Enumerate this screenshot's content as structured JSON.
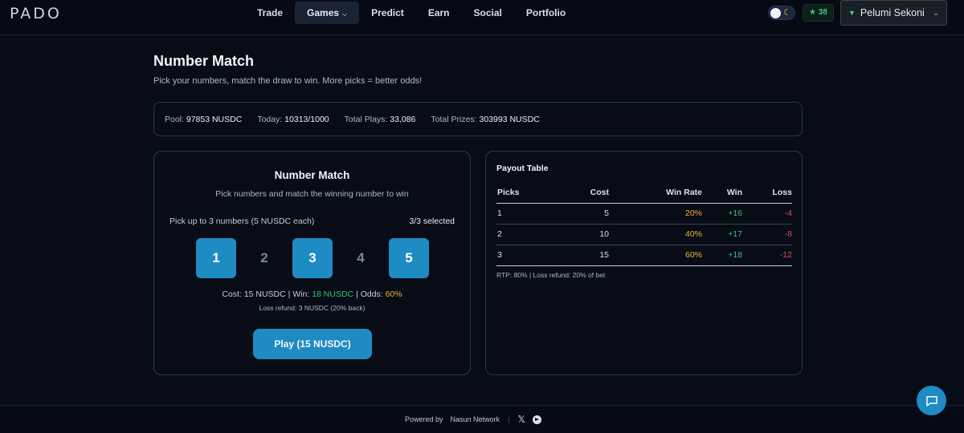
{
  "header": {
    "logo": "PADO",
    "nav": [
      {
        "label": "Trade",
        "active": false
      },
      {
        "label": "Games",
        "active": true
      },
      {
        "label": "Predict",
        "active": false
      },
      {
        "label": "Earn",
        "active": false
      },
      {
        "label": "Social",
        "active": false
      },
      {
        "label": "Portfolio",
        "active": false
      }
    ],
    "points": "38",
    "user_name": "Pelumi Sekoni"
  },
  "page": {
    "title": "Number Match",
    "subtitle": "Pick your numbers, match the draw to win. More picks = better odds!"
  },
  "stats": [
    {
      "label": "Pool:",
      "value": "97853 NUSDC"
    },
    {
      "label": "Today:",
      "value": "10313/1000"
    },
    {
      "label": "Total Plays:",
      "value": "33,086"
    },
    {
      "label": "Total Prizes:",
      "value": "303993 NUSDC"
    }
  ],
  "game": {
    "title": "Number Match",
    "subtitle": "Pick numbers and match the winning number to win",
    "pick_hint": "Pick up to 3 numbers (5 NUSDC each)",
    "pick_count": "3/3 selected",
    "numbers": [
      {
        "value": "1",
        "selected": true
      },
      {
        "value": "2",
        "selected": false
      },
      {
        "value": "3",
        "selected": true
      },
      {
        "value": "4",
        "selected": false
      },
      {
        "value": "5",
        "selected": true
      }
    ],
    "cost_label": "Cost: 15 NUSDC",
    "win_label": "Win:",
    "win_value": "18 NUSDC",
    "odds_label": "Odds:",
    "odds_value": "60%",
    "refund": "Loss refund: 3 NUSDC (20% back)",
    "play_button": "Play (15 NUSDC)"
  },
  "payout": {
    "title": "Payout Table",
    "headers": [
      "Picks",
      "Cost",
      "Win Rate",
      "Win",
      "Loss"
    ],
    "rows": [
      [
        "1",
        "5",
        "20%",
        "+16",
        "-4"
      ],
      [
        "2",
        "10",
        "40%",
        "+17",
        "-8"
      ],
      [
        "3",
        "15",
        "60%",
        "+18",
        "-12"
      ]
    ],
    "note": "RTP: 80% | Loss refund: 20% of bet"
  },
  "footer": {
    "powered_by": "Powered by",
    "network": "Nasun Network"
  },
  "colors": {
    "accent": "#1e8bc3",
    "win": "#35c46f",
    "odds": "#f2b42c",
    "loss": "#e0504a"
  }
}
